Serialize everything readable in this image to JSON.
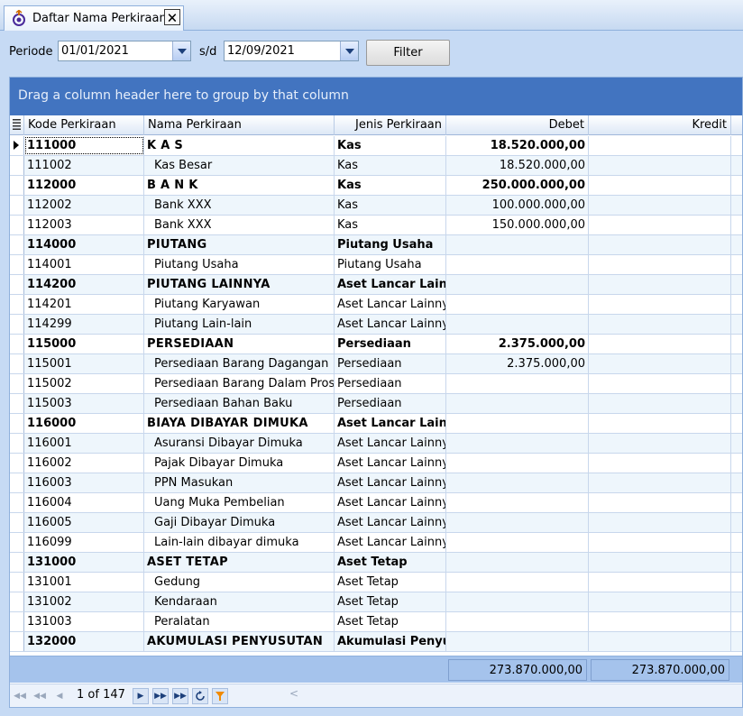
{
  "tab": {
    "title": "Daftar Nama Perkiraan",
    "close_glyph": "🗙",
    "icon": "app-logo-icon"
  },
  "filter": {
    "periode_label": "Periode",
    "from_date": "01/01/2021",
    "sd_label": "s/d",
    "to_date": "12/09/2021",
    "filter_button": "Filter"
  },
  "grid": {
    "group_panel_text": "Drag a column header here to group by that column",
    "columns": [
      "Kode Perkiraan",
      "Nama Perkiraan",
      "Jenis Perkiraan",
      "Debet",
      "Kredit"
    ],
    "rows": [
      {
        "kode": "111000",
        "nama": "K A S",
        "jenis": "Kas",
        "debet": "18.520.000,00",
        "kredit": "",
        "bold": true,
        "indent": false
      },
      {
        "kode": "111002",
        "nama": "Kas Besar",
        "jenis": "Kas",
        "debet": "18.520.000,00",
        "kredit": "",
        "bold": false,
        "indent": true
      },
      {
        "kode": "112000",
        "nama": "B A N K",
        "jenis": "Kas",
        "debet": "250.000.000,00",
        "kredit": "",
        "bold": true,
        "indent": false
      },
      {
        "kode": "112002",
        "nama": "Bank XXX",
        "jenis": "Kas",
        "debet": "100.000.000,00",
        "kredit": "",
        "bold": false,
        "indent": true
      },
      {
        "kode": "112003",
        "nama": "Bank XXX",
        "jenis": "Kas",
        "debet": "150.000.000,00",
        "kredit": "",
        "bold": false,
        "indent": true
      },
      {
        "kode": "114000",
        "nama": "PIUTANG",
        "jenis": "Piutang Usaha",
        "debet": "",
        "kredit": "",
        "bold": true,
        "indent": false
      },
      {
        "kode": "114001",
        "nama": "Piutang Usaha",
        "jenis": "Piutang Usaha",
        "debet": "",
        "kredit": "",
        "bold": false,
        "indent": true
      },
      {
        "kode": "114200",
        "nama": "PIUTANG LAINNYA",
        "jenis": "Aset Lancar Lainnya",
        "debet": "",
        "kredit": "",
        "bold": true,
        "indent": false
      },
      {
        "kode": "114201",
        "nama": "Piutang Karyawan",
        "jenis": "Aset Lancar Lainnya",
        "debet": "",
        "kredit": "",
        "bold": false,
        "indent": true
      },
      {
        "kode": "114299",
        "nama": "Piutang Lain-lain",
        "jenis": "Aset Lancar Lainnya",
        "debet": "",
        "kredit": "",
        "bold": false,
        "indent": true
      },
      {
        "kode": "115000",
        "nama": "PERSEDIAAN",
        "jenis": "Persediaan",
        "debet": "2.375.000,00",
        "kredit": "",
        "bold": true,
        "indent": false
      },
      {
        "kode": "115001",
        "nama": "Persediaan Barang Dagangan",
        "jenis": "Persediaan",
        "debet": "2.375.000,00",
        "kredit": "",
        "bold": false,
        "indent": true
      },
      {
        "kode": "115002",
        "nama": "Persediaan Barang Dalam Proses",
        "jenis": "Persediaan",
        "debet": "",
        "kredit": "",
        "bold": false,
        "indent": true
      },
      {
        "kode": "115003",
        "nama": "Persediaan Bahan Baku",
        "jenis": "Persediaan",
        "debet": "",
        "kredit": "",
        "bold": false,
        "indent": true
      },
      {
        "kode": "116000",
        "nama": "BIAYA DIBAYAR DIMUKA",
        "jenis": "Aset Lancar Lainnya",
        "debet": "",
        "kredit": "",
        "bold": true,
        "indent": false
      },
      {
        "kode": "116001",
        "nama": "Asuransi Dibayar Dimuka",
        "jenis": "Aset Lancar Lainnya",
        "debet": "",
        "kredit": "",
        "bold": false,
        "indent": true
      },
      {
        "kode": "116002",
        "nama": "Pajak Dibayar Dimuka",
        "jenis": "Aset Lancar Lainnya",
        "debet": "",
        "kredit": "",
        "bold": false,
        "indent": true
      },
      {
        "kode": "116003",
        "nama": "PPN Masukan",
        "jenis": "Aset Lancar Lainnya",
        "debet": "",
        "kredit": "",
        "bold": false,
        "indent": true
      },
      {
        "kode": "116004",
        "nama": "Uang Muka Pembelian",
        "jenis": "Aset Lancar Lainnya",
        "debet": "",
        "kredit": "",
        "bold": false,
        "indent": true
      },
      {
        "kode": "116005",
        "nama": "Gaji Dibayar Dimuka",
        "jenis": "Aset Lancar Lainnya",
        "debet": "",
        "kredit": "",
        "bold": false,
        "indent": true
      },
      {
        "kode": "116099",
        "nama": "Lain-lain dibayar dimuka",
        "jenis": "Aset Lancar Lainnya",
        "debet": "",
        "kredit": "",
        "bold": false,
        "indent": true
      },
      {
        "kode": "131000",
        "nama": "ASET TETAP",
        "jenis": "Aset Tetap",
        "debet": "",
        "kredit": "",
        "bold": true,
        "indent": false
      },
      {
        "kode": "131001",
        "nama": "Gedung",
        "jenis": "Aset Tetap",
        "debet": "",
        "kredit": "",
        "bold": false,
        "indent": true
      },
      {
        "kode": "131002",
        "nama": "Kendaraan",
        "jenis": "Aset Tetap",
        "debet": "",
        "kredit": "",
        "bold": false,
        "indent": true
      },
      {
        "kode": "131003",
        "nama": "Peralatan",
        "jenis": "Aset Tetap",
        "debet": "",
        "kredit": "",
        "bold": false,
        "indent": true
      },
      {
        "kode": "132000",
        "nama": "AKUMULASI PENYUSUTAN",
        "jenis": "Akumulasi Penyusutan",
        "debet": "",
        "kredit": "",
        "bold": true,
        "indent": false
      }
    ],
    "footer": {
      "total_debet": "273.870.000,00",
      "total_kredit": "273.870.000,00"
    }
  },
  "navigator": {
    "page_text": "1 of 147",
    "icons": [
      "first-record-icon",
      "previous-page-icon",
      "previous-record-icon",
      "next-record-icon",
      "next-page-icon",
      "last-record-icon",
      "refresh-icon",
      "filter-icon"
    ]
  },
  "colors": {
    "group_panel": "#4274c0",
    "alt_row": "#eef6fc",
    "footer": "#a5c3ec",
    "background": "#c6daf4"
  }
}
